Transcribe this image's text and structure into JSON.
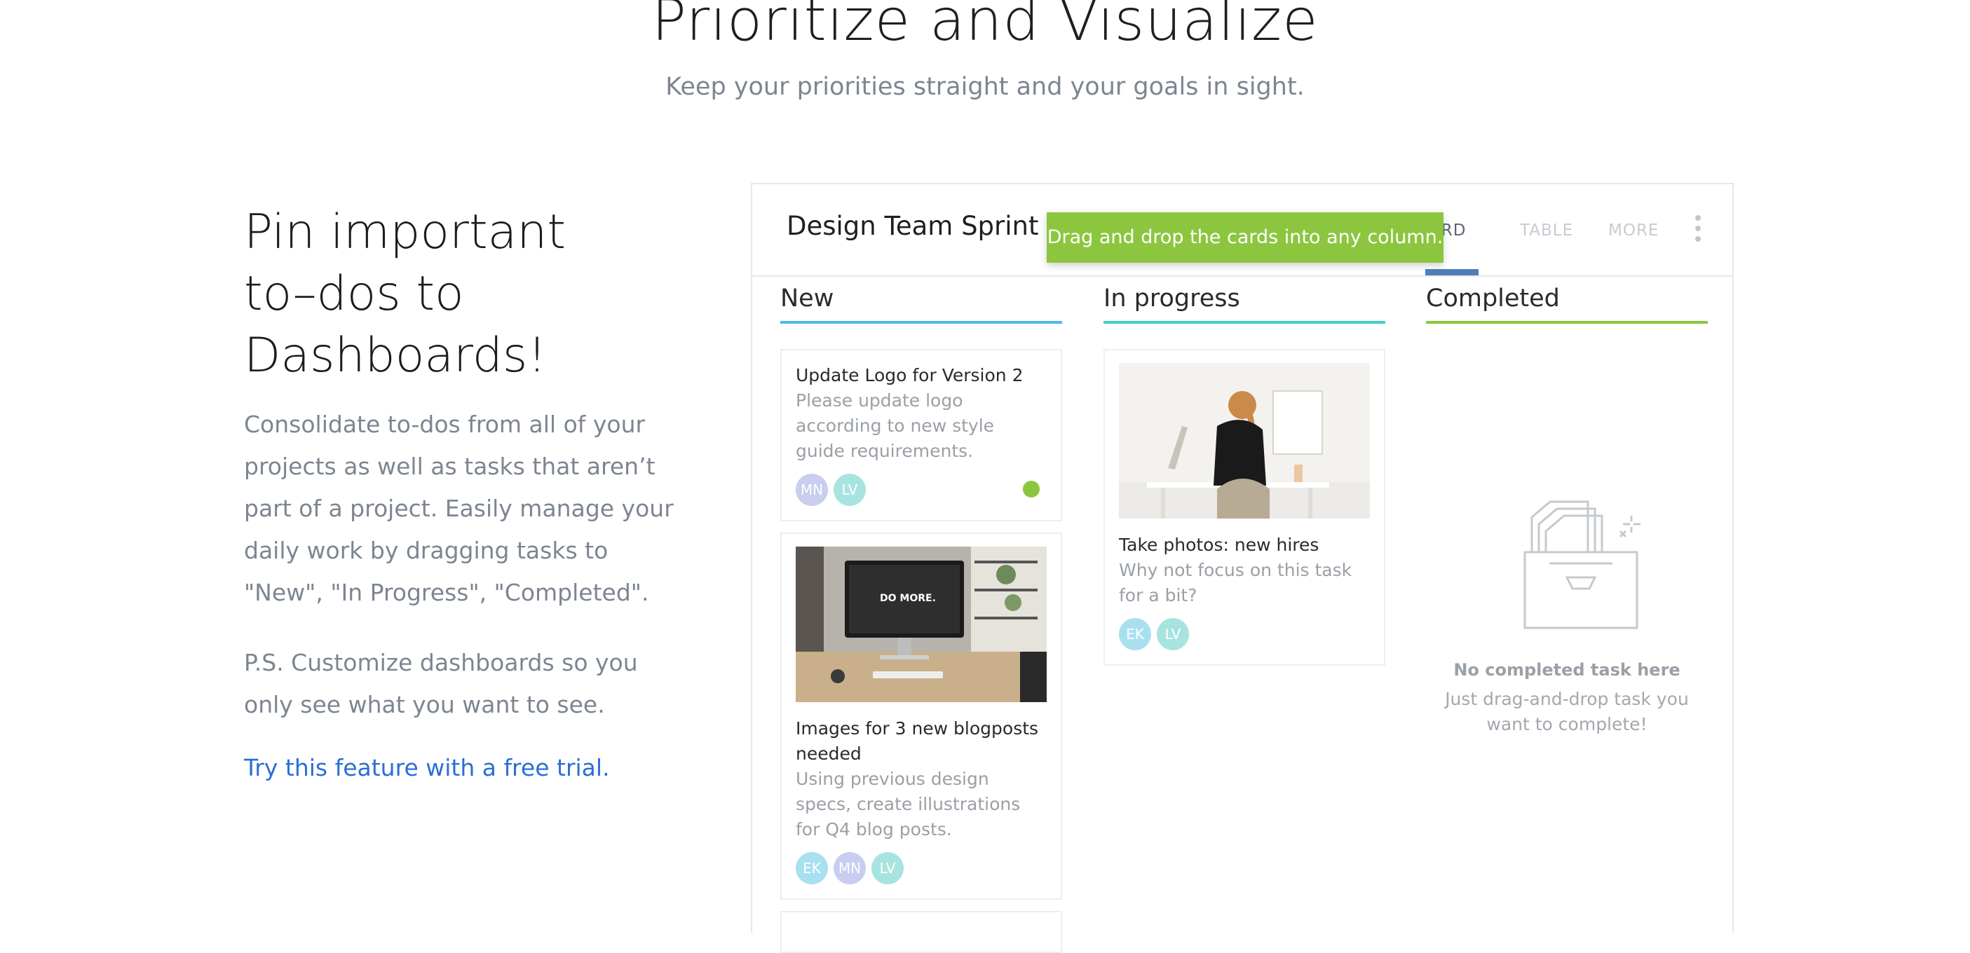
{
  "hero": {
    "title": "Prioritize and Visualize",
    "subtitle": "Keep your priorities straight and your goals in sight."
  },
  "feature": {
    "heading": [
      "Pin important",
      "to–dos to",
      "Dashboards!"
    ],
    "paragraph": "Consolidate to-dos from all of your projects as well as tasks that aren’t part of a project. Easily manage your daily work by dragging tasks to \"New\", \"In Progress\", \"Completed\".",
    "ps": "P.S. Customize dashboards so you only see what you want to see.",
    "cta": "Try this feature with a free trial."
  },
  "board": {
    "title": "Design Team Sprint",
    "tooltip": "Drag and drop the cards into any column.",
    "tabs": {
      "board": "BOARD",
      "table": "TABLE",
      "more": "MORE"
    },
    "active_tab_visible_text": "ARD",
    "columns": [
      {
        "title": "New",
        "color": "#4fb9e8",
        "cards": [
          {
            "title": "Update Logo for Version 2",
            "desc": "Please update logo according to new style guide requirements.",
            "avatars": [
              {
                "initials": "MN",
                "color": "#c9cdef"
              },
              {
                "initials": "LV",
                "color": "#a8e4df"
              }
            ],
            "status_color": "#8cc63f"
          },
          {
            "title": "Images for 3 new blogposts needed",
            "desc": "Using previous design specs, create illustrations for Q4 blog posts.",
            "image": "desk-computer-photo",
            "image_text": "DO MORE.",
            "avatars": [
              {
                "initials": "EK",
                "color": "#a9e0f0"
              },
              {
                "initials": "MN",
                "color": "#c9cdef"
              },
              {
                "initials": "LV",
                "color": "#a8e4df"
              }
            ]
          }
        ]
      },
      {
        "title": "In progress",
        "color": "#45d0c4",
        "cards": [
          {
            "title": "Take photos: new hires",
            "desc": "Why not focus on this task for a bit?",
            "image": "woman-at-desk-photo",
            "avatars": [
              {
                "initials": "EK",
                "color": "#a9e0f0"
              },
              {
                "initials": "LV",
                "color": "#a8e4df"
              }
            ]
          }
        ]
      },
      {
        "title": "Completed",
        "color": "#8cc63f",
        "empty": {
          "title": "No completed task here",
          "text": "Just drag-and-drop task you want to complete!",
          "icon": "empty-inbox-icon"
        }
      }
    ]
  }
}
